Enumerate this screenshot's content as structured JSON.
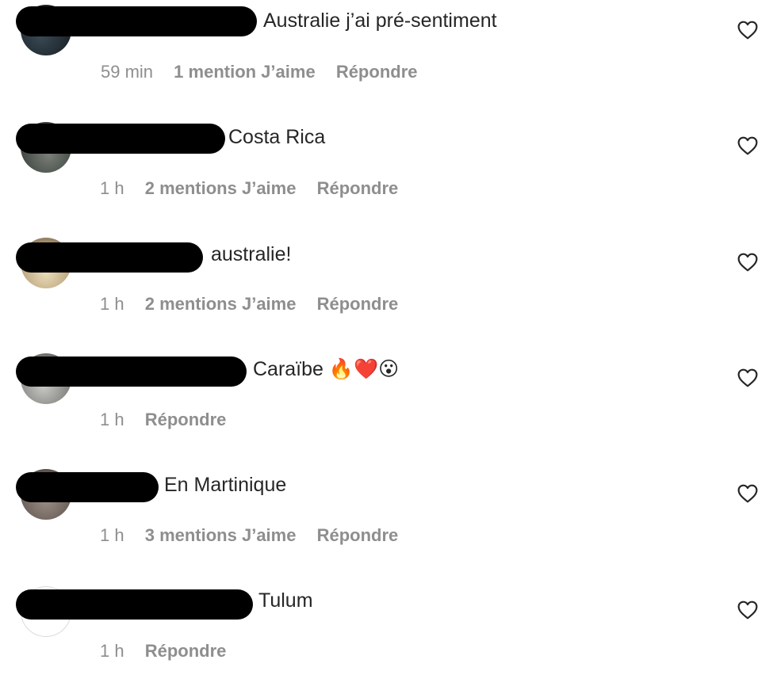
{
  "comments": [
    {
      "text": "Australie j’ai pré-sentiment",
      "time": "59 min",
      "likes": "1 mention J’aime",
      "reply": "Répondre"
    },
    {
      "text": "Costa Rica",
      "time": "1 h",
      "likes": "2 mentions J’aime",
      "reply": "Répondre"
    },
    {
      "text": "australie!",
      "time": "1 h",
      "likes": "2 mentions J’aime",
      "reply": "Répondre"
    },
    {
      "text": "Caraïbe 🔥❤️😮",
      "time": "1 h",
      "likes": "",
      "reply": "Répondre"
    },
    {
      "text": "En Martinique",
      "time": "1 h",
      "likes": "3 mentions J’aime",
      "reply": "Répondre"
    },
    {
      "text": "Tulum",
      "time": "1 h",
      "likes": "",
      "reply": "Répondre"
    }
  ],
  "icons": {
    "like": "heart-outline-icon"
  },
  "colors": {
    "text": "#262626",
    "meta": "#8e8e8e",
    "redaction": "#000000"
  }
}
